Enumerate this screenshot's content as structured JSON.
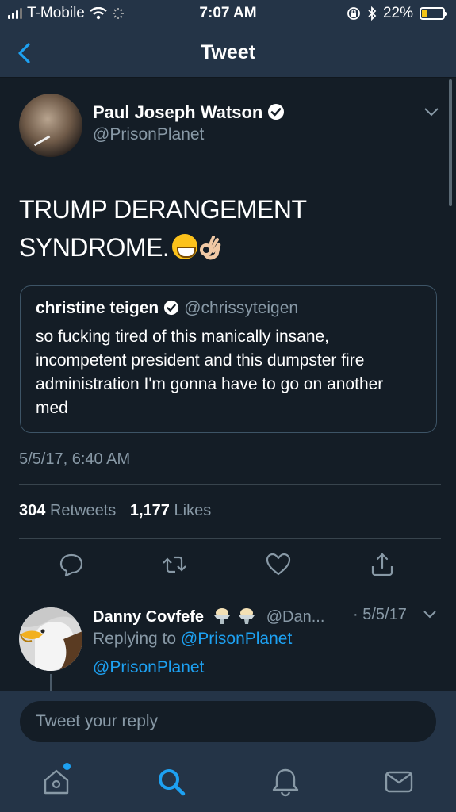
{
  "status_bar": {
    "carrier": "T-Mobile",
    "time": "7:07 AM",
    "battery_percent": "22%",
    "battery_level": 0.22
  },
  "nav": {
    "title": "Tweet"
  },
  "tweet": {
    "author_name": "Paul Joseph Watson",
    "author_handle": "@PrisonPlanet",
    "text_line1": "TRUMP DERANGEMENT",
    "text_line2": "SYNDROME.",
    "emoji": [
      "grinning-face",
      "ok-hand-light-skin"
    ],
    "quote": {
      "name": "christine teigen",
      "handle": "@chrissyteigen",
      "text": "so fucking tired of this manically insane, incompetent president and this dumpster fire administration I'm gonna have to go on another med"
    },
    "timestamp": "5/5/17, 6:40 AM",
    "retweets_count": "304",
    "retweets_label": "Retweets",
    "likes_count": "1,177",
    "likes_label": "Likes"
  },
  "actions": [
    "reply-icon",
    "retweet-icon",
    "like-icon",
    "share-icon"
  ],
  "reply": {
    "name": "Danny Covfefe",
    "handle": "@Dan...",
    "date": "· 5/5/17",
    "replying_prefix": "Replying to",
    "replying_to": "@PrisonPlanet",
    "text": "@PrisonPlanet"
  },
  "composer": {
    "placeholder": "Tweet your reply"
  },
  "tabs": [
    "home-icon",
    "search-icon",
    "notifications-icon",
    "messages-icon"
  ],
  "colors": {
    "background": "#141d26",
    "bar": "#243447",
    "accent": "#1da1f2",
    "secondary_text": "#8899a6"
  }
}
